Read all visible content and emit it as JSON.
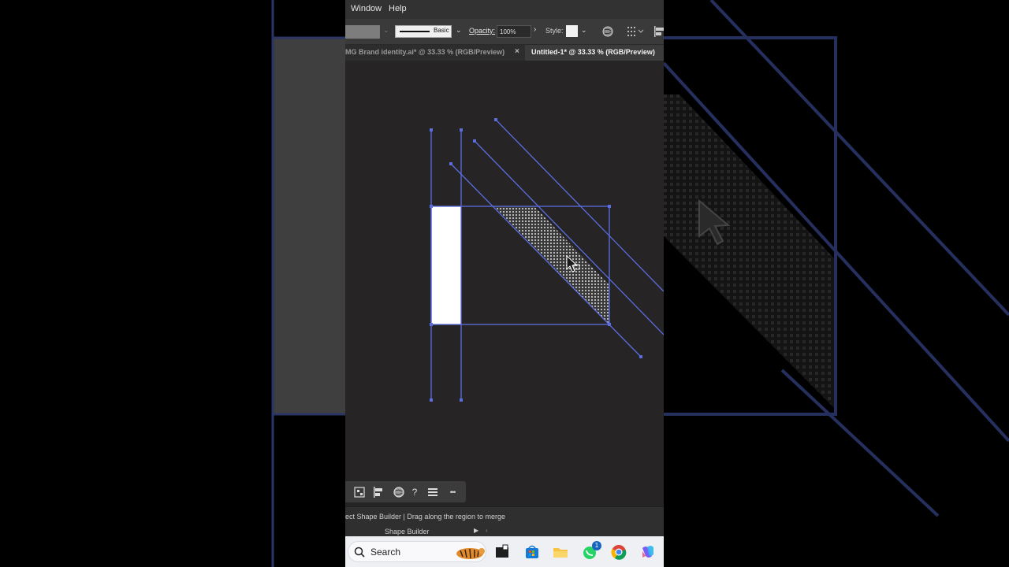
{
  "menu": {
    "window": "Window",
    "help": "Help"
  },
  "controls": {
    "stroke_profile": "Basic",
    "opacity_label": "Opacity:",
    "opacity_value": "100%",
    "style_label": "Style:"
  },
  "tabs": [
    {
      "label": "MG Brand identity.ai* @ 33.33 % (RGB/Preview)",
      "close": "×"
    },
    {
      "label": "Untitled-1* @ 33.33 % (RGB/Preview)"
    }
  ],
  "status": {
    "hint": "ect Shape Builder  |  Drag along the region to merge",
    "tool": "Shape Builder",
    "arrow": "▶",
    "collapse": "‹"
  },
  "float_toolbar": {
    "help": "?",
    "more": "•••"
  },
  "taskbar": {
    "search_placeholder": "Search",
    "whatsapp_badge": "1"
  },
  "colors": {
    "canvas": "#262425",
    "path": "#5b6ee0",
    "highlight": "#b0b0b0",
    "fill": "#ffffff",
    "taskbar": "#eef0f4"
  },
  "icons": [
    "selection-icon",
    "align-icon",
    "globe-icon",
    "help-icon",
    "menu-icon",
    "more-icon",
    "search-icon",
    "tiger-widget-icon",
    "file-explorer-icon",
    "store-icon",
    "folder-icon",
    "whatsapp-icon",
    "chrome-icon",
    "copilot-icon"
  ]
}
